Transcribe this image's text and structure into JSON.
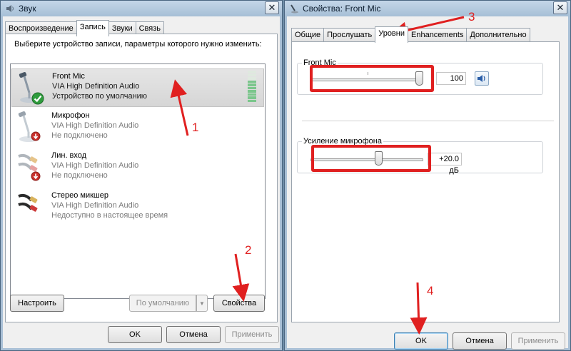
{
  "left_window": {
    "title": "Звук",
    "close_label": "✕",
    "tabs": [
      {
        "label": "Воспроизведение"
      },
      {
        "label": "Запись",
        "active": true
      },
      {
        "label": "Звуки"
      },
      {
        "label": "Связь"
      }
    ],
    "prompt": "Выберите устройство записи, параметры которого нужно изменить:",
    "devices": [
      {
        "name": "Front Mic",
        "driver": "VIA High Definition Audio",
        "status": "Устройство по умолчанию",
        "selected": true,
        "icon": "microphone-icon",
        "badge": "default-check-icon"
      },
      {
        "name": "Микрофон",
        "driver": "VIA High Definition Audio",
        "status": "Не подключено",
        "icon": "microphone-icon",
        "badge": "unplugged-icon"
      },
      {
        "name": "Лин. вход",
        "driver": "VIA High Definition Audio",
        "status": "Не подключено",
        "icon": "line-in-cable-icon",
        "badge": "unplugged-icon"
      },
      {
        "name": "Стерео микшер",
        "driver": "VIA High Definition Audio",
        "status": "Недоступно в настоящее время",
        "icon": "stereo-mix-cable-icon"
      }
    ],
    "buttons": {
      "configure": "Настроить",
      "set_default": "По умолчанию",
      "properties": "Свойства",
      "ok": "OK",
      "cancel": "Отмена",
      "apply": "Применить"
    }
  },
  "right_window": {
    "title": "Свойства: Front Mic",
    "close_label": "✕",
    "tabs": [
      {
        "label": "Общие"
      },
      {
        "label": "Прослушать"
      },
      {
        "label": "Уровни",
        "active": true
      },
      {
        "label": "Enhancements"
      },
      {
        "label": "Дополнительно"
      }
    ],
    "levels": {
      "volume": {
        "label": "Front Mic",
        "value_text": "100",
        "level": 100
      },
      "boost": {
        "label": "Усиление микрофона",
        "value_text": "+20.0 дБ",
        "level": 0.5
      }
    },
    "buttons": {
      "ok": "OK",
      "cancel": "Отмена",
      "apply": "Применить"
    }
  },
  "annotations": {
    "labels": [
      "1",
      "2",
      "3",
      "4"
    ],
    "color": "#e02020"
  },
  "colors": {
    "title_bar": "#a9c0d6",
    "selection": "#d9d9d9",
    "level_green": "#7bc68c",
    "annotation_red": "#e02020"
  }
}
